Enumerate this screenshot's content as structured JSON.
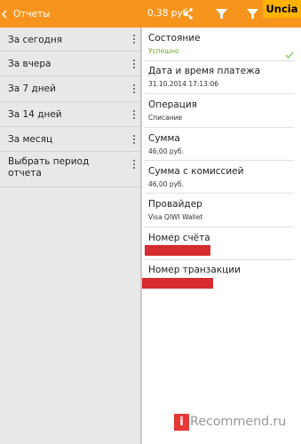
{
  "actionbar": {
    "title": "Отчеты",
    "balance": "0,38 руб.",
    "bg_color": "#f7941d",
    "icons": [
      "back-arrow-icon",
      "share-icon",
      "filter-icon",
      "filter-icon"
    ]
  },
  "watermark_top": {
    "text": "Uncia"
  },
  "reports": {
    "items": [
      {
        "label": "За сегодня"
      },
      {
        "label": "За вчера"
      },
      {
        "label": "За 7 дней"
      },
      {
        "label": "За 14 дней"
      },
      {
        "label": "За месяц"
      },
      {
        "label": "Выбрать период отчета"
      }
    ]
  },
  "details": {
    "status": {
      "label": "Состояние",
      "value": "Успешно",
      "value_color": "#6dab2b",
      "icon": "check-icon"
    },
    "datetime": {
      "label": "Дата и время платежа",
      "value": "31.10.2014 17:13:06"
    },
    "operation": {
      "label": "Операция",
      "value": "Списание"
    },
    "sum": {
      "label": "Сумма",
      "value": "46,00 руб."
    },
    "sum_commission": {
      "label": "Сумма с комиссией",
      "value": "46,00 руб."
    },
    "provider": {
      "label": "Провайдер",
      "value": "Visa QIWI Wallet"
    },
    "account": {
      "label": "Номер счёта"
    },
    "transaction": {
      "label": "Номер транзакции"
    },
    "redaction_color": "#d62b2f"
  },
  "watermark_bottom": {
    "logo": "i",
    "text": "Recommend.ru"
  }
}
